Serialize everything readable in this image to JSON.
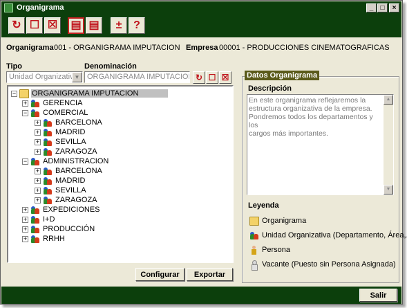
{
  "window": {
    "title": "Organigrama",
    "controls": [
      "_",
      "□",
      "×"
    ]
  },
  "toolbar": {
    "buttons": [
      {
        "name": "refresh",
        "glyph": "↻"
      },
      {
        "name": "new",
        "glyph": "☐"
      },
      {
        "name": "delete",
        "glyph": "☒"
      },
      {
        "name": "report",
        "glyph": "▤",
        "active": true
      },
      {
        "name": "list",
        "glyph": "▤"
      },
      {
        "name": "plus-minus",
        "glyph": "±"
      },
      {
        "name": "help",
        "glyph": "?"
      }
    ]
  },
  "header": {
    "organigrama_label": "Organigrama",
    "organigrama_value": "001 - ORGANIGRAMA IMPUTACION",
    "empresa_label": "Empresa",
    "empresa_value": "00001 - PRODUCCIONES CINEMATOGRAFICAS"
  },
  "form": {
    "tipo_label": "Tipo",
    "tipo_value": "Unidad Organizativa",
    "denominacion_label": "Denominación",
    "denominacion_value": "ORGANIGRAMA IMPUTACION"
  },
  "tree": {
    "root": "ORGANIGRAMA IMPUTACION",
    "nodes": [
      {
        "label": "GERENCIA",
        "expander": "+"
      },
      {
        "label": "COMERCIAL",
        "expander": "−"
      },
      {
        "label": "BARCELONA",
        "expander": "+"
      },
      {
        "label": "MADRID",
        "expander": "+"
      },
      {
        "label": "SEVILLA",
        "expander": "+"
      },
      {
        "label": "ZARAGOZA",
        "expander": "+"
      },
      {
        "label": "ADMINISTRACION",
        "expander": "−"
      },
      {
        "label": "BARCELONA",
        "expander": "+"
      },
      {
        "label": "MADRID",
        "expander": "+"
      },
      {
        "label": "SEVILLA",
        "expander": "+"
      },
      {
        "label": "ZARAGOZA",
        "expander": "+"
      },
      {
        "label": "EXPEDICIONES",
        "expander": "+"
      },
      {
        "label": "I+D",
        "expander": "+"
      },
      {
        "label": "PRODUCCIÓN",
        "expander": "+"
      },
      {
        "label": "RRHH",
        "expander": "+"
      }
    ]
  },
  "buttons": {
    "configurar": "Configurar",
    "exportar": "Exportar",
    "salir": "Salir"
  },
  "datos": {
    "group_title": "Datos Organigrama",
    "descripcion_label": "Descripción",
    "descripcion_lines": [
      "En este organigrama reflejaremos la",
      "estructura organizativa de la empresa.",
      "Pondremos todos los departamentos y los",
      "cargos más importantes."
    ],
    "leyenda_label": "Leyenda",
    "legend": [
      {
        "label": "Organigrama",
        "icon": "folder-icon"
      },
      {
        "label": "Unidad Organizativa (Departamento, Área,...)",
        "icon": "org-unit-icon"
      },
      {
        "label": "Persona",
        "icon": "person-icon"
      },
      {
        "label": "Vacante (Puesto sin Persona Asignada)",
        "icon": "vacancy-icon"
      }
    ]
  },
  "colors": {
    "frame": "#0c3f0c",
    "accent_red": "#c0141c",
    "group_title_bg": "#5a5a1a"
  }
}
